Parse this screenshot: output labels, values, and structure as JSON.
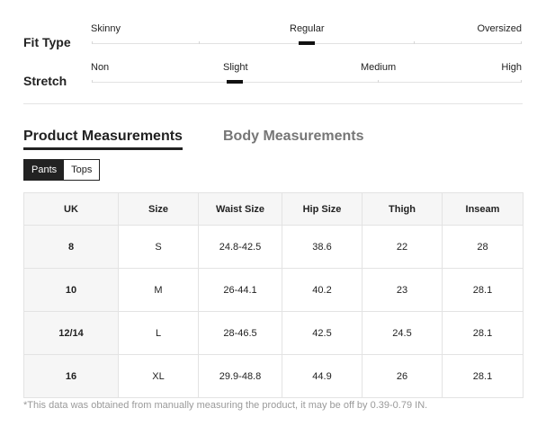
{
  "fit_type": {
    "label": "Fit Type",
    "options": [
      "Skinny",
      "Regular",
      "Oversized"
    ],
    "selected": "Regular"
  },
  "stretch": {
    "label": "Stretch",
    "options": [
      "Non",
      "Slight",
      "Medium",
      "High"
    ],
    "selected": "Slight"
  },
  "tabs": {
    "product": "Product Measurements",
    "body": "Body Measurements",
    "active": "Product Measurements"
  },
  "category": {
    "pants": "Pants",
    "tops": "Tops",
    "selected": "Pants"
  },
  "table": {
    "headers": [
      "UK",
      "Size",
      "Waist Size",
      "Hip Size",
      "Thigh",
      "Inseam"
    ],
    "rows": [
      [
        "8",
        "S",
        "24.8-42.5",
        "38.6",
        "22",
        "28"
      ],
      [
        "10",
        "M",
        "26-44.1",
        "40.2",
        "23",
        "28.1"
      ],
      [
        "12/14",
        "L",
        "28-46.5",
        "42.5",
        "24.5",
        "28.1"
      ],
      [
        "16",
        "XL",
        "29.9-48.8",
        "44.9",
        "26",
        "28.1"
      ]
    ]
  },
  "footnote": "*This data was obtained from manually measuring the product, it may be off by 0.39-0.79 IN."
}
